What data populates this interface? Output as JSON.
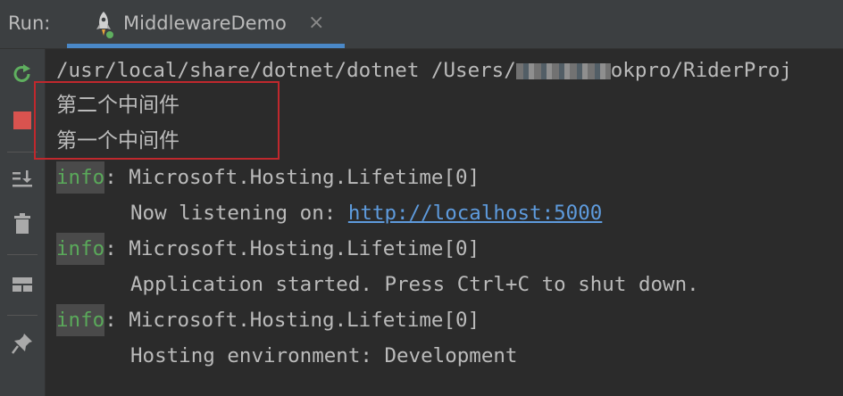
{
  "topbar": {
    "run_label": "Run:",
    "tab": {
      "title": "MiddlewareDemo",
      "close_glyph": "×",
      "icon": "rocket-icon"
    }
  },
  "toolbar": {
    "icons": [
      "rerun-icon",
      "stop-icon",
      "scroll-to-end-icon",
      "trash-icon",
      "layout-icon",
      "pin-icon"
    ],
    "colors": {
      "rerun": "#5faf5f",
      "stop": "#d9534f",
      "neutral": "#aaaaaa"
    }
  },
  "console": {
    "command_prefix": "/usr/local/share/dotnet/dotnet /Users/",
    "command_suffix": "okpro/RiderProj",
    "output_cn_1": "第二个中间件",
    "output_cn_2": "第一个中间件",
    "info_tag": "info",
    "logs": [
      {
        "category": ": Microsoft.Hosting.Lifetime[0]",
        "message_prefix": "Now listening on: ",
        "link": "http://localhost:5000",
        "message": ""
      },
      {
        "category": ": Microsoft.Hosting.Lifetime[0]",
        "message": "Application started. Press Ctrl+C to shut down."
      },
      {
        "category": ": Microsoft.Hosting.Lifetime[0]",
        "message": "Hosting environment: Development"
      }
    ]
  },
  "colors": {
    "background": "#2b2b2b",
    "panel": "#3c3f41",
    "text": "#bbbbbb",
    "info_text": "#5aa95a",
    "link": "#5e9bdd",
    "highlight_border": "#c0282d",
    "tab_underline": "#4a88c7"
  }
}
